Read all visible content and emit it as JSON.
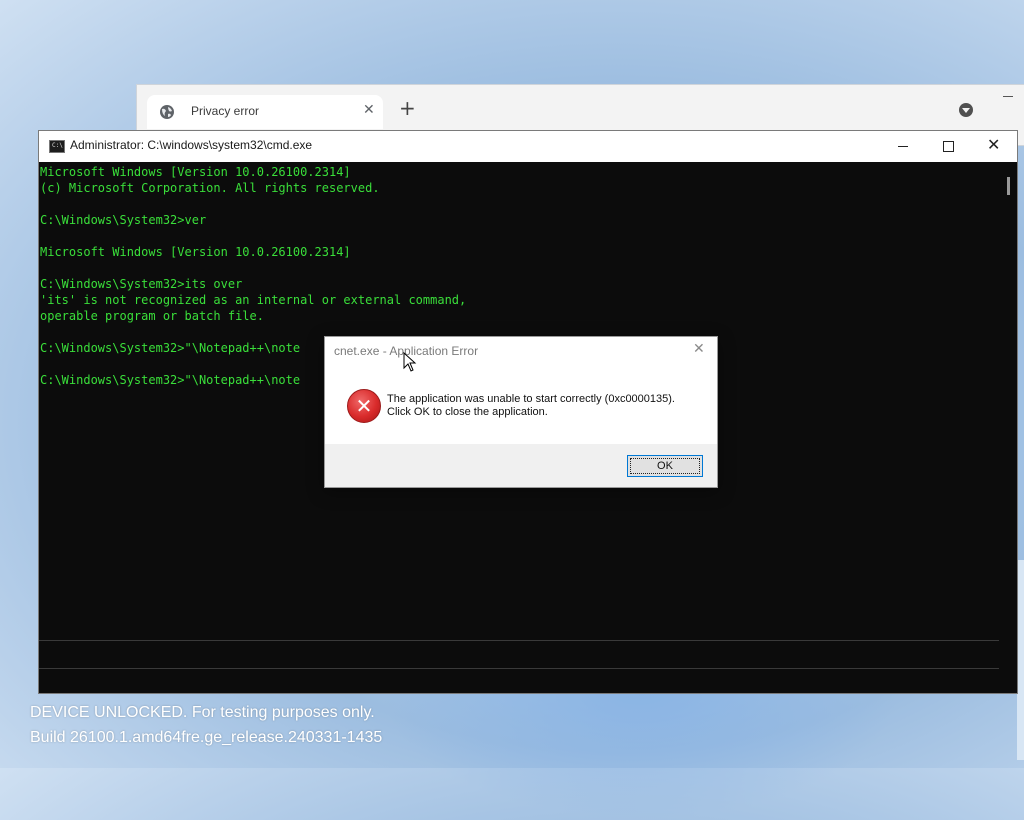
{
  "browser": {
    "tab_title": "Privacy error",
    "tab_close": "✕",
    "new_tab": "+",
    "globe_icon": "globe-icon"
  },
  "cmd_window": {
    "title": "Administrator: C:\\windows\\system32\\cmd.exe",
    "icon_label": "C:\\",
    "minimize": "—",
    "maximize": "☐",
    "close": "✕",
    "lines": [
      "Microsoft Windows [Version 10.0.26100.2314]",
      "(c) Microsoft Corporation. All rights reserved.",
      "",
      "C:\\Windows\\System32>ver",
      "",
      "Microsoft Windows [Version 10.0.26100.2314]",
      "",
      "C:\\Windows\\System32>its over",
      "'its' is not recognized as an internal or external command,",
      "operable program or batch file.",
      "",
      "C:\\Windows\\System32>\"\\Notepad++\\note",
      "",
      "C:\\Windows\\System32>\"\\Notepad++\\note"
    ],
    "text_color": "#3adf3a"
  },
  "error_dialog": {
    "title": "cnet.exe - Application Error",
    "close": "✕",
    "message_line1": "The application was unable to start correctly (0xc0000135).",
    "message_line2": "Click OK to close the application.",
    "ok_label": "OK",
    "icon": "error-x-icon",
    "icon_glyph": "✕"
  },
  "watermark": {
    "line1": "DEVICE UNLOCKED. For testing purposes only.",
    "line2": "Build 26100.1.amd64fre.ge_release.240331-1435"
  }
}
